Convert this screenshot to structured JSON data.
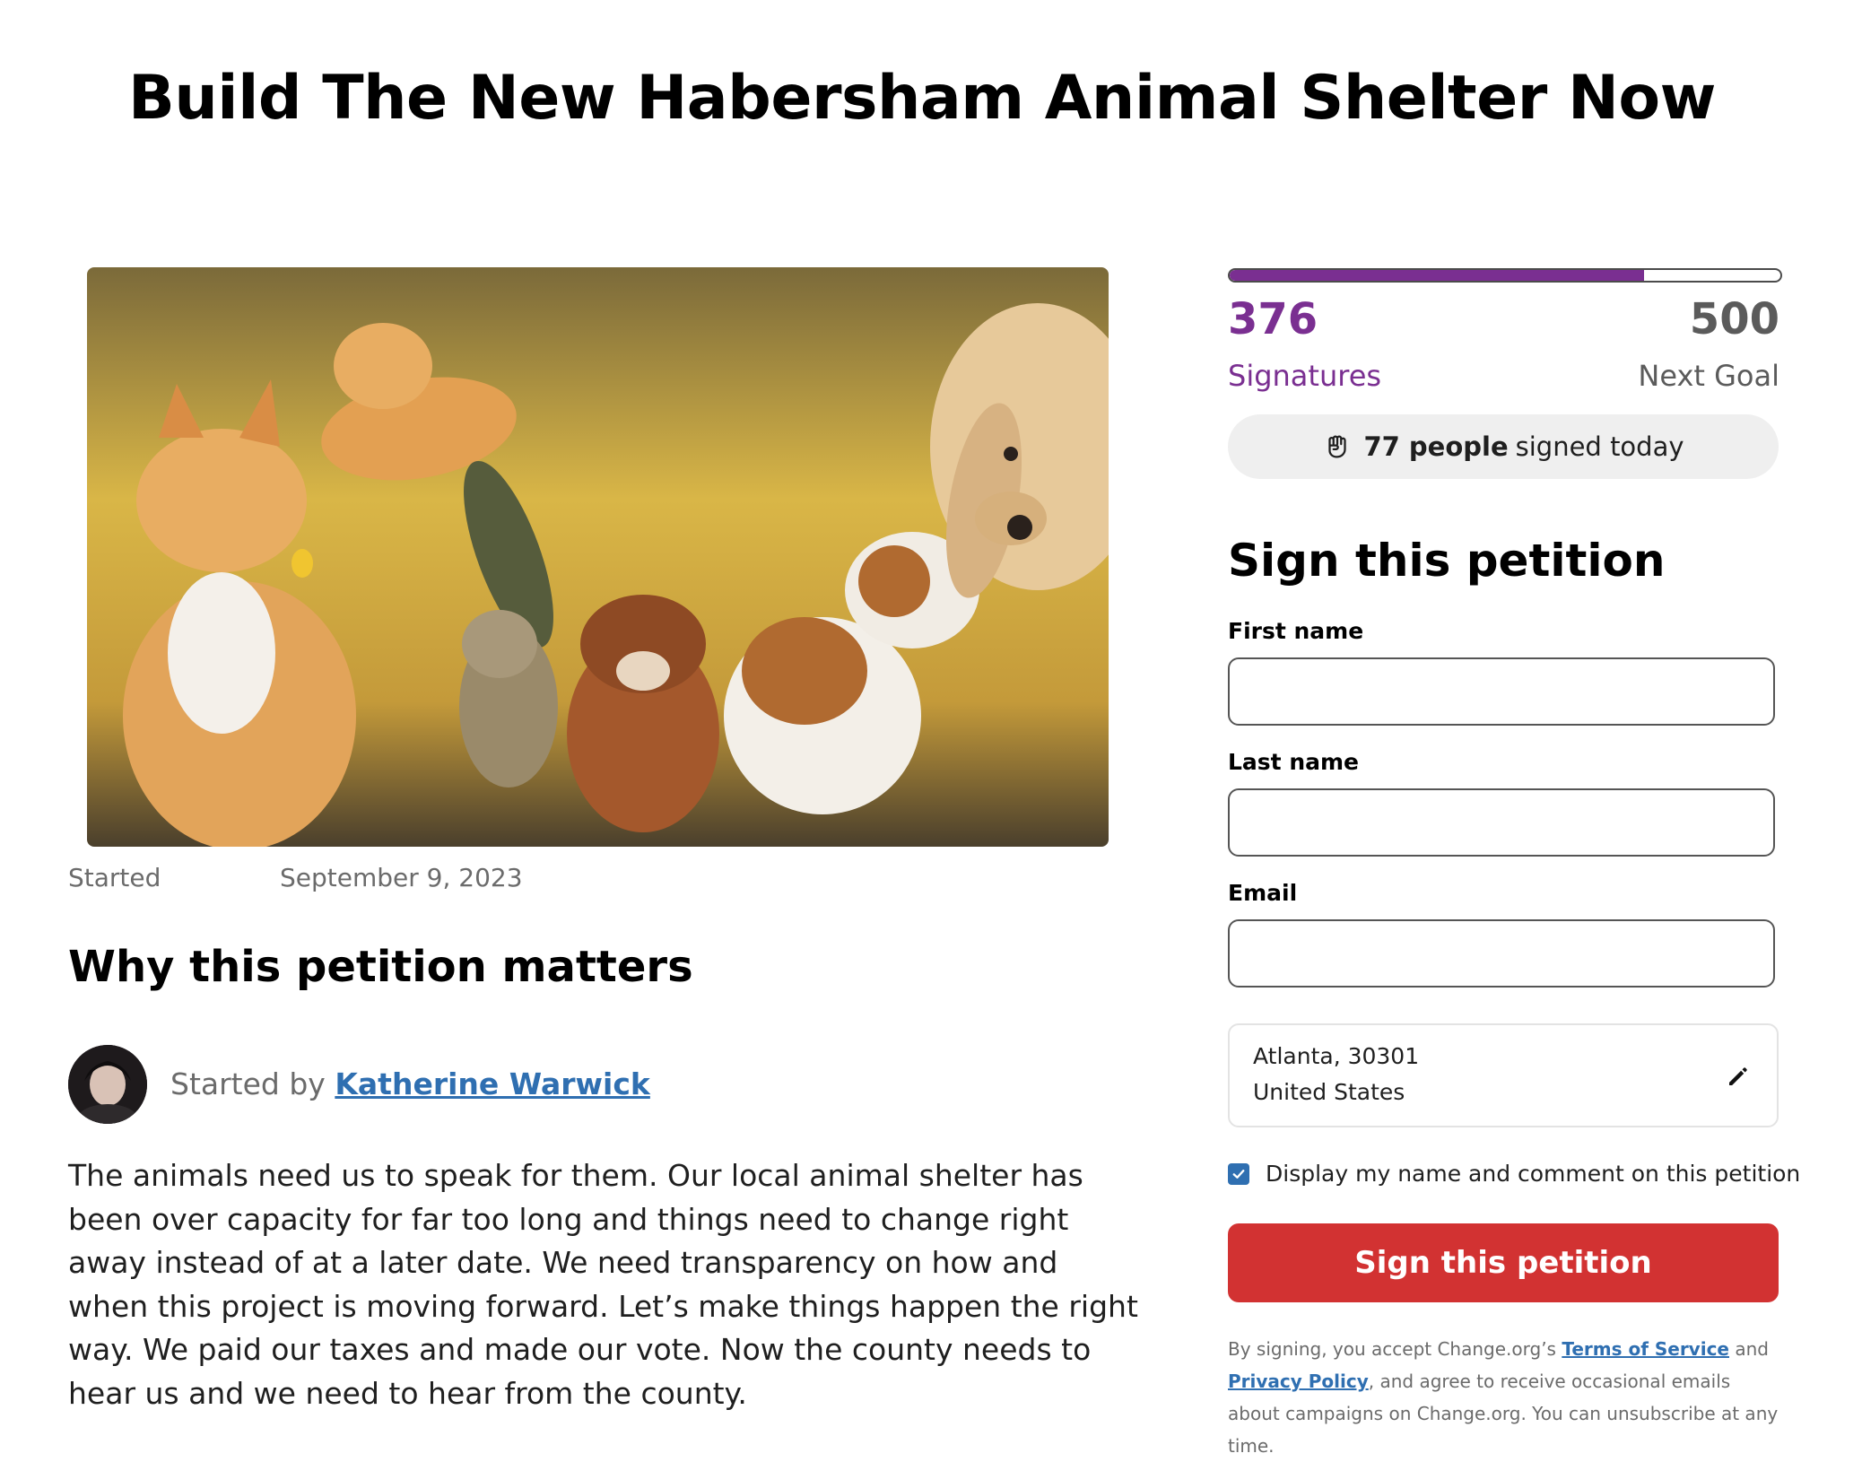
{
  "page": {
    "title": "Build The New Habersham Animal Shelter Now"
  },
  "hero": {
    "image_alt": "cats and dogs"
  },
  "meta": {
    "started_label": "Started",
    "started_date": "September 9, 2023"
  },
  "story": {
    "heading": "Why this petition matters",
    "started_by_prefix": "Started by",
    "author": "Katherine Warwick",
    "body": "The animals need us to speak for them. Our local animal shelter has been over capacity for far too long and things need to change right away instead of at a later date. We need transparency on how and when this project is moving forward.  Let’s make things happen the right way. We paid our taxes and made our vote. Now the county needs to hear us and we need to hear from the county."
  },
  "signatures": {
    "count": "376",
    "goal": "500",
    "count_label": "Signatures",
    "goal_label": "Next Goal",
    "progress_fraction": 0.752,
    "today_bold": "77 people",
    "today_rest": "signed today"
  },
  "form": {
    "heading": "Sign this petition",
    "first_name_label": "First name",
    "first_name_value": "",
    "last_name_label": "Last name",
    "last_name_value": "",
    "email_label": "Email",
    "email_value": "",
    "location_line1": "Atlanta, 30301",
    "location_line2": "United States",
    "display_checkbox_label": "Display my name and comment on this petition",
    "display_checked": true,
    "submit_label": "Sign this petition"
  },
  "legal": {
    "prefix": "By signing, you accept Change.org’s",
    "terms_link": "Terms of Service",
    "and": "and",
    "privacy_link": "Privacy Policy",
    "suffix": ", and agree to receive occasional emails about campaigns on Change.org. You can unsubscribe at any time."
  },
  "colors": {
    "accent_purple": "#7a2f91",
    "button_red": "#d23232",
    "link_blue": "#2f6fb1"
  },
  "icons": {
    "today_icon": "raised-fist-icon",
    "location_edit_icon": "pencil-icon",
    "checkbox_icon": "checkmark-icon"
  }
}
